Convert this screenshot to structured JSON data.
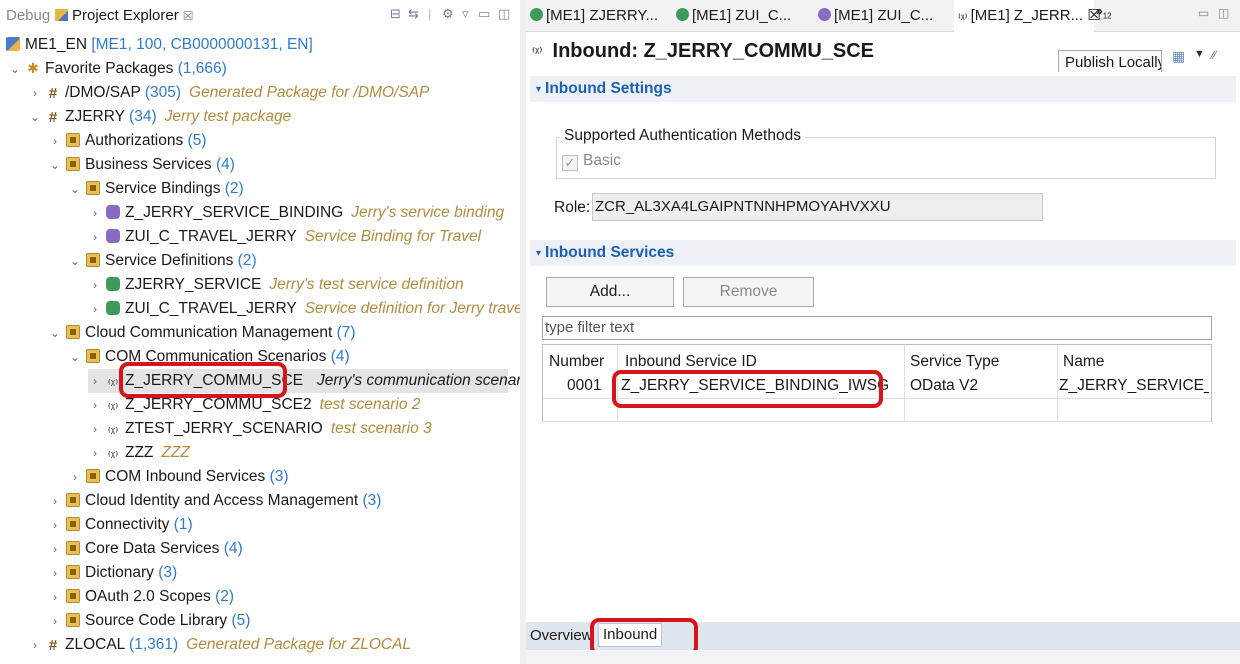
{
  "explorer": {
    "tab_debug": "Debug",
    "tab_project_explorer": "Project Explorer",
    "tab_close": "☒",
    "tree": [
      {
        "label": "ME1_EN",
        "count": "",
        "suffix": " [ME1, 100, CB0000000131, EN]",
        "desc": ""
      },
      {
        "label": "Favorite Packages",
        "count": "(1,666)",
        "desc": ""
      },
      {
        "label": "/DMO/SAP",
        "count": "(305)",
        "desc": "Generated Package for /DMO/SAP"
      },
      {
        "label": "ZJERRY",
        "count": "(34)",
        "desc": "Jerry test package"
      },
      {
        "label": "Authorizations",
        "count": "(5)",
        "desc": ""
      },
      {
        "label": "Business Services",
        "count": "(4)",
        "desc": ""
      },
      {
        "label": "Service Bindings",
        "count": "(2)",
        "desc": ""
      },
      {
        "label": "Z_JERRY_SERVICE_BINDING",
        "count": "",
        "desc": "Jerry's service binding"
      },
      {
        "label": "ZUI_C_TRAVEL_JERRY",
        "count": "",
        "desc": "Service Binding for Travel"
      },
      {
        "label": "Service Definitions",
        "count": "(2)",
        "desc": ""
      },
      {
        "label": "ZJERRY_SERVICE",
        "count": "",
        "desc": "Jerry's test service definition"
      },
      {
        "label": "ZUI_C_TRAVEL_JERRY",
        "count": "",
        "desc": "Service definition for Jerry travel"
      },
      {
        "label": "Cloud Communication Management",
        "count": "(7)",
        "desc": ""
      },
      {
        "label": "COM Communication Scenarios",
        "count": "(4)",
        "desc": ""
      },
      {
        "label": "Z_JERRY_COMMU_SCE",
        "count": "",
        "desc": "Jerry's communication scenario"
      },
      {
        "label": "Z_JERRY_COMMU_SCE2",
        "count": "",
        "desc": "test scenario 2"
      },
      {
        "label": "ZTEST_JERRY_SCENARIO",
        "count": "",
        "desc": "test scenario 3"
      },
      {
        "label": "ZZZ",
        "count": "",
        "desc": "ZZZ"
      },
      {
        "label": "COM Inbound Services",
        "count": "(3)",
        "desc": ""
      },
      {
        "label": "Cloud Identity and Access Management",
        "count": "(3)",
        "desc": ""
      },
      {
        "label": "Connectivity",
        "count": "(1)",
        "desc": ""
      },
      {
        "label": "Core Data Services",
        "count": "(4)",
        "desc": ""
      },
      {
        "label": "Dictionary",
        "count": "(3)",
        "desc": ""
      },
      {
        "label": "OAuth 2.0 Scopes",
        "count": "(2)",
        "desc": ""
      },
      {
        "label": "Source Code Library",
        "count": "(5)",
        "desc": ""
      },
      {
        "label": "ZLOCAL",
        "count": "(1,361)",
        "desc": "Generated Package for ZLOCAL"
      }
    ]
  },
  "editor_tabs": [
    {
      "label": "[ME1] ZJERRY..."
    },
    {
      "label": "[ME1] ZUI_C..."
    },
    {
      "label": "[ME1] ZUI_C..."
    },
    {
      "label": "[ME1] Z_JERR... ☒"
    }
  ],
  "more_tabs": "»",
  "more_tabs_count": "12",
  "editor": {
    "title": "Inbound: Z_JERRY_COMMU_SCE",
    "publish_label": "Publish Locally",
    "inbound_settings_header": "Inbound Settings",
    "auth_methods_legend": "Supported Authentication Methods",
    "basic_label": "Basic",
    "basic_check": "✓",
    "role_label": "Role:",
    "role_value": "ZCR_AL3XA4LGAIPNTNNHPMOYAHVXXU",
    "inbound_services_header": "Inbound Services",
    "add_button": "Add...",
    "remove_button": "Remove",
    "filter_placeholder": "type filter text",
    "table": {
      "headers": [
        "Number",
        "Inbound Service ID",
        "Service Type",
        "Name"
      ],
      "rows": [
        [
          "0001",
          "Z_JERRY_SERVICE_BINDING_IWSG",
          "OData V2",
          "Z_JERRY_SERVICE_BIN"
        ]
      ]
    },
    "bottom_tabs": [
      "Overview",
      "Inbound"
    ]
  },
  "colors": {
    "highlight_red": "#d8141b",
    "link_blue": "#2f7bd0",
    "desc_gold": "#b48a3d",
    "section_blue": "#1d5fb3"
  }
}
